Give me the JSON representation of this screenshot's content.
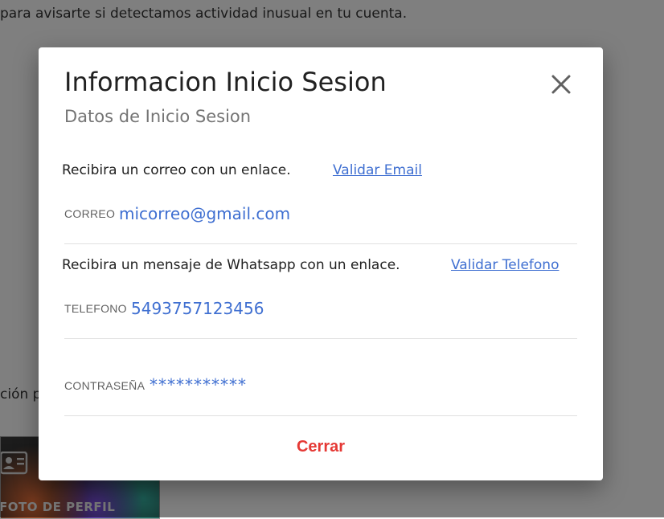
{
  "background": {
    "top_text": "para avisarte si detectamos actividad inusual en tu cuenta.",
    "mid_text": "ción p",
    "profile_label": "FOTO DE PERFIL",
    "profile_icon": "id-card-icon"
  },
  "modal": {
    "title": "Informacion Inicio Sesion",
    "subtitle": "Datos de Inicio Sesion",
    "close_icon": "close-icon",
    "email_section": {
      "description": "Recibira un correo con un enlace.",
      "link_label": "Validar Email",
      "field_label": "CORREO",
      "field_value": "micorreo@gmail.com"
    },
    "phone_section": {
      "description": "Recibira un mensaje de Whatsapp con un enlace.",
      "link_label": "Validar Telefono",
      "field_label": "TELEFONO",
      "field_value": "5493757123456"
    },
    "password_section": {
      "field_label": "CONTRASEÑA",
      "field_value": "***********"
    },
    "close_button_label": "Cerrar"
  },
  "colors": {
    "accent_link": "#3f6fd1",
    "close_button": "#e53935",
    "overlay": "rgba(0,0,0,0.5)"
  }
}
